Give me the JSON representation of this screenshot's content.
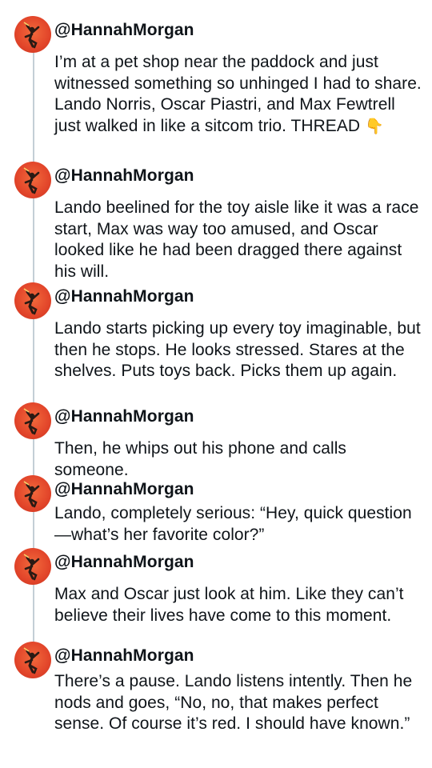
{
  "thread": {
    "tweets": [
      {
        "handle": "@HannahMorgan",
        "text": "I’m at a pet shop near the paddock and just witnessed something so unhinged I had to share. Lando Norris, Oscar Piastri, and Max Fewtrell just walked in like a sitcom trio. THREAD",
        "emoji": "👇"
      },
      {
        "handle": "@HannahMorgan",
        "text": "Lando beelined for the toy aisle like it was a race start, Max was way too amused, and Oscar looked like he had been dragged there against his will."
      },
      {
        "handle": "@HannahMorgan",
        "text": "Lando starts picking up every toy imaginable, but then he stops. He looks stressed. Stares at the shelves. Puts toys back. Picks them up again."
      },
      {
        "handle": "@HannahMorgan",
        "text": "Then, he whips out his phone and calls someone."
      },
      {
        "handle": "@HannahMorgan",
        "text": "Lando, completely serious: “Hey, quick question—what’s her favorite color?”"
      },
      {
        "handle": "@HannahMorgan",
        "text": "Max and Oscar just look at him. Like they can’t believe their lives have come to this moment."
      },
      {
        "handle": "@HannahMorgan",
        "text": "There’s a pause. Lando listens intently. Then he nods and goes, “No, no, that makes perfect sense. Of course it’s red. I should have known.”"
      }
    ]
  },
  "avatar": {
    "icon": "avatar-figure-icon",
    "background_color": "#e2452a"
  },
  "thread_line_color": "#c4cfd6"
}
